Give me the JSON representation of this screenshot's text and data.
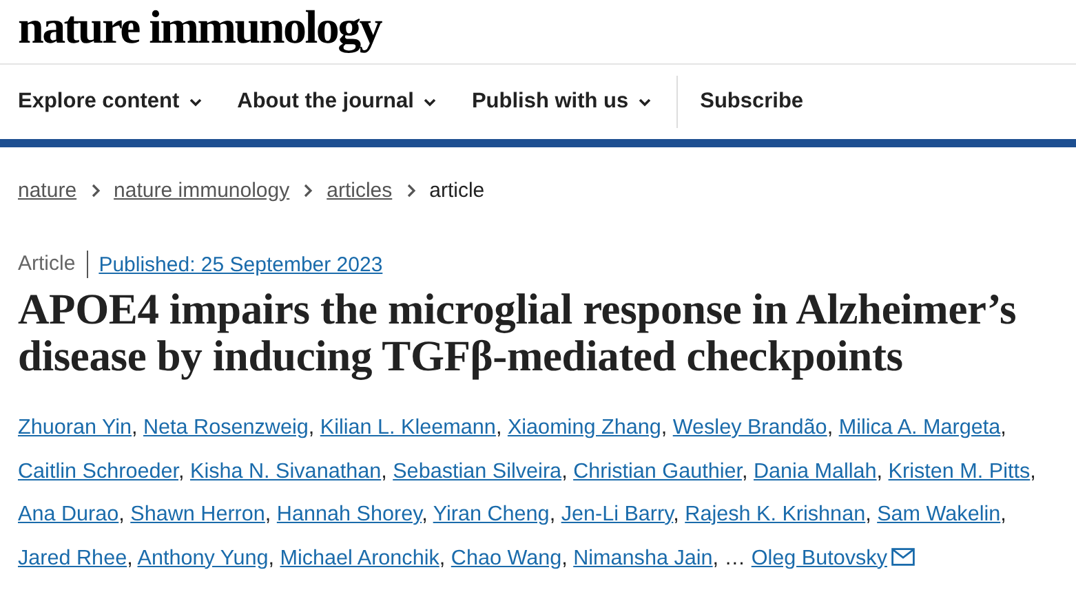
{
  "logo": "nature immunology",
  "nav": [
    {
      "label": "Explore content",
      "dropdown": true
    },
    {
      "label": "About the journal",
      "dropdown": true
    },
    {
      "label": "Publish with us",
      "dropdown": true
    },
    {
      "label": "Subscribe",
      "dropdown": false
    }
  ],
  "breadcrumbs": [
    {
      "label": "nature",
      "link": true
    },
    {
      "label": "nature immunology",
      "link": true
    },
    {
      "label": "articles",
      "link": true
    },
    {
      "label": "article",
      "link": false
    }
  ],
  "article": {
    "type": "Article",
    "published": "Published: 25 September 2023",
    "title": "APOE4 impairs the microglial response in Alzheimer’s disease by inducing TGFβ-mediated checkpoints",
    "authors": [
      {
        "name": "Zhuoran Yin",
        "separator": ",",
        "corresponding": false
      },
      {
        "name": "Neta Rosenzweig",
        "separator": ",",
        "corresponding": false
      },
      {
        "name": "Kilian L. Kleemann",
        "separator": ",",
        "corresponding": false
      },
      {
        "name": "Xiaoming Zhang",
        "separator": ",",
        "corresponding": false
      },
      {
        "name": "Wesley Brandão",
        "separator": ",",
        "corresponding": false
      },
      {
        "name": "Milica A. Margeta",
        "separator": ",",
        "corresponding": false
      },
      {
        "name": "Caitlin Schroeder",
        "separator": ",",
        "corresponding": false
      },
      {
        "name": "Kisha N. Sivanathan",
        "separator": ",",
        "corresponding": false
      },
      {
        "name": "Sebastian Silveira",
        "separator": ",",
        "corresponding": false
      },
      {
        "name": "Christian Gauthier",
        "separator": ",",
        "corresponding": false
      },
      {
        "name": "Dania Mallah",
        "separator": ",",
        "corresponding": false
      },
      {
        "name": "Kristen M. Pitts",
        "separator": ",",
        "corresponding": false
      },
      {
        "name": "Ana Durao",
        "separator": ",",
        "corresponding": false
      },
      {
        "name": "Shawn Herron",
        "separator": ",",
        "corresponding": false
      },
      {
        "name": "Hannah Shorey",
        "separator": ",",
        "corresponding": false
      },
      {
        "name": "Yiran Cheng",
        "separator": ",",
        "corresponding": false
      },
      {
        "name": "Jen-Li Barry",
        "separator": ",",
        "corresponding": false
      },
      {
        "name": "Rajesh K. Krishnan",
        "separator": ",",
        "corresponding": false
      },
      {
        "name": "Sam Wakelin",
        "separator": ",",
        "corresponding": false
      },
      {
        "name": "Jared Rhee",
        "separator": ",",
        "corresponding": false
      },
      {
        "name": "Anthony Yung",
        "separator": ",",
        "corresponding": false
      },
      {
        "name": "Michael Aronchik",
        "separator": ",",
        "corresponding": false
      },
      {
        "name": "Chao Wang",
        "separator": ",",
        "corresponding": false
      },
      {
        "name": "Nimansha Jain",
        "separator": ",",
        "corresponding": false
      },
      {
        "name": "Oleg Butovsky",
        "corresponding": true
      }
    ],
    "ellipsis": "…"
  }
}
